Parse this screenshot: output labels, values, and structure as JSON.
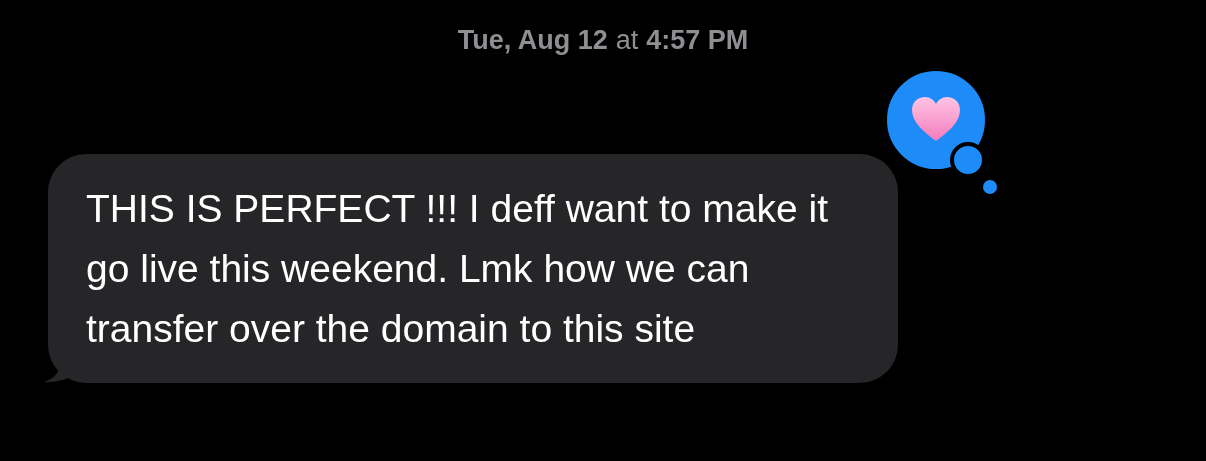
{
  "timestamp": {
    "day": "Tue, Aug 12",
    "connector": "at",
    "time": "4:57 PM"
  },
  "message": {
    "text": "THIS IS PERFECT !!! I deff want to make it go live this weekend. Lmk how we can transfer over the domain to this site",
    "reaction": {
      "kind": "heart"
    }
  }
}
